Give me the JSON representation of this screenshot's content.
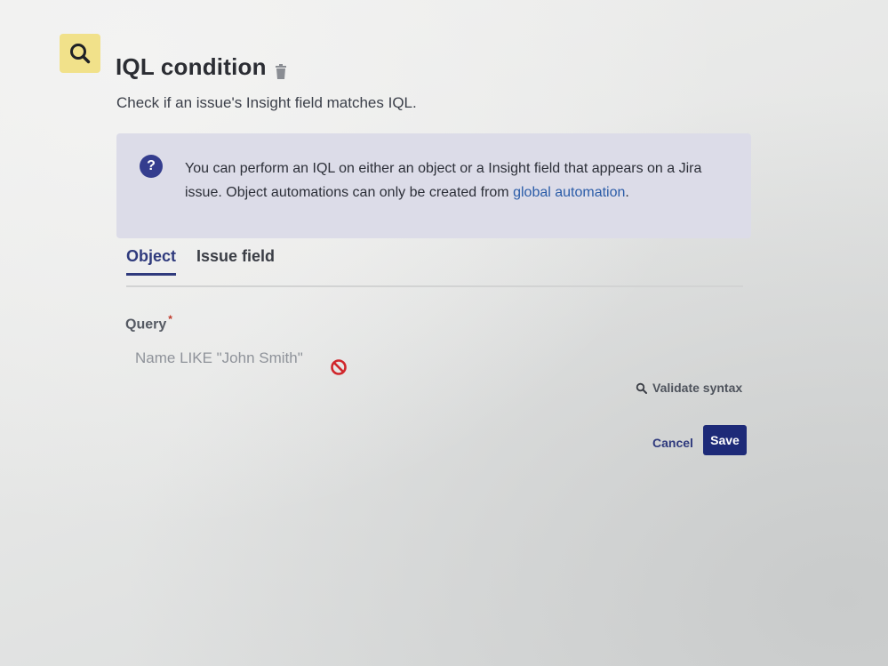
{
  "header": {
    "title": "IQL condition",
    "subtitle": "Check if an issue's Insight field matches IQL.",
    "icons": {
      "main": "search-icon",
      "delete": "trash-icon"
    },
    "accent_color": "#f1e18a"
  },
  "info": {
    "icon": "help-icon",
    "text": "You can perform an IQL on either an object or a Insight field that appears on a Jira issue. Object automations can only be created from",
    "link_text": "global automation",
    "text_end": "."
  },
  "tabs": [
    {
      "label": "Object",
      "active": true
    },
    {
      "label": "Issue field",
      "active": false
    }
  ],
  "query": {
    "label": "Query",
    "required_mark": "*",
    "placeholder": "Name LIKE \"John Smith\"",
    "value": "",
    "status_icon": "block-icon"
  },
  "actions": {
    "validate_label": "Validate syntax",
    "cancel_label": "Cancel",
    "save_label": "Save",
    "primary_color": "#1d2a78"
  }
}
